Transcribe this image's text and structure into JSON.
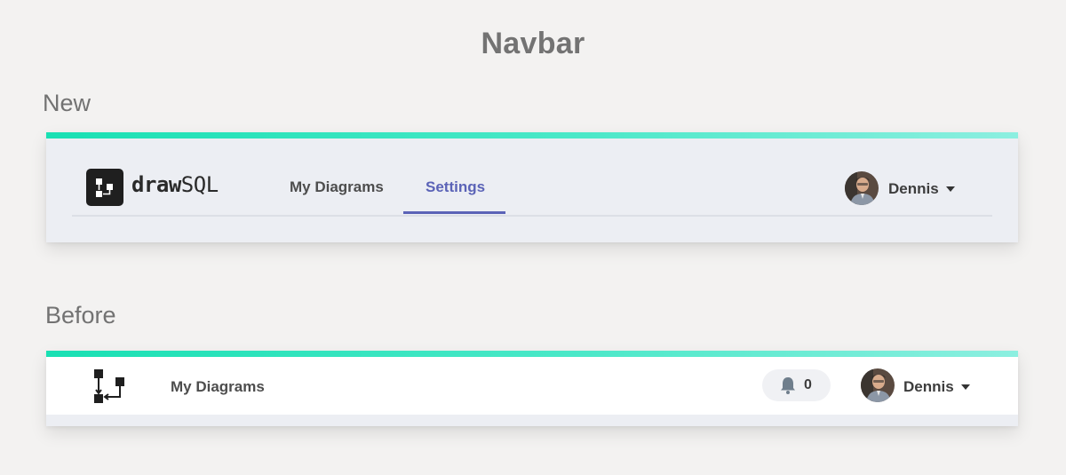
{
  "page": {
    "title": "Navbar"
  },
  "new_section": {
    "label": "New",
    "logo": {
      "wordmark_bold": "draw",
      "wordmark_light": "SQL",
      "icon": "diagram-logo-icon"
    },
    "nav_links": [
      {
        "label": "My Diagrams",
        "active": false
      },
      {
        "label": "Settings",
        "active": true
      }
    ],
    "user": {
      "name": "Dennis",
      "avatar": "user-avatar",
      "menu_icon": "caret-down-icon"
    },
    "colors": {
      "accent": "#19e0b3",
      "active_link": "#5b63b7",
      "background": "#eceef3"
    }
  },
  "before_section": {
    "label": "Before",
    "logo": {
      "icon": "diagram-logo-icon"
    },
    "nav_links": [
      {
        "label": "My Diagrams",
        "active": false
      }
    ],
    "notifications": {
      "icon": "bell-icon",
      "count": "0"
    },
    "user": {
      "name": "Dennis",
      "avatar": "user-avatar",
      "menu_icon": "caret-down-icon"
    },
    "colors": {
      "accent": "#19e0b3",
      "background": "#ffffff"
    }
  }
}
